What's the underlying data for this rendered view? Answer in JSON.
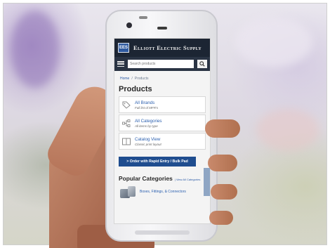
{
  "brand": {
    "name": "Elliott Electric Supply",
    "logo_text": "EES"
  },
  "search": {
    "placeholder": "Search products"
  },
  "breadcrumb": {
    "home": "Home",
    "separator": "/",
    "current": "Products"
  },
  "page_title": "Products",
  "cards": [
    {
      "title": "All Brands",
      "subtitle": "Full list of MFR's",
      "icon": "tag-icon"
    },
    {
      "title": "All Categories",
      "subtitle": "All items by type",
      "icon": "hierarchy-icon"
    },
    {
      "title": "Catalog View",
      "subtitle": "Classic print layout",
      "icon": "book-icon"
    }
  ],
  "rapid_entry_button": "> Order with Rapid Entry / Bulk Pad",
  "popular": {
    "title": "Popular Categories",
    "view_all": "| View All Categories",
    "items": [
      {
        "label": "Boxes, Fittings, & Connectors"
      }
    ]
  },
  "colors": {
    "brand_bar": "#1c2533",
    "link": "#2d61b0",
    "button": "#1f4d8f"
  }
}
